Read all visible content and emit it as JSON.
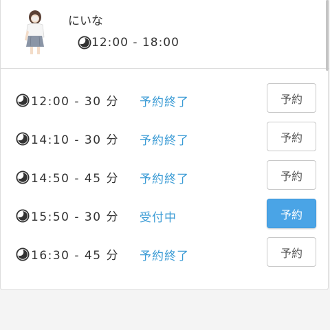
{
  "profile": {
    "name": "にいな",
    "hours": "12:00 - 18:00",
    "icon": "clock-icon"
  },
  "slots": [
    {
      "time": "12:00 - 30 分",
      "status": "予約終了",
      "button": "予約",
      "active": false
    },
    {
      "time": "14:10 - 30 分",
      "status": "予約終了",
      "button": "予約",
      "active": false
    },
    {
      "time": "14:50 - 45 分",
      "status": "予約終了",
      "button": "予約",
      "active": false
    },
    {
      "time": "15:50 - 30 分",
      "status": "受付中",
      "button": "予約",
      "active": true
    },
    {
      "time": "16:30 - 45 分",
      "status": "予約終了",
      "button": "予約",
      "active": false
    }
  ],
  "colors": {
    "status_text": "#3a9bd5",
    "active_button": "#4aa4e6"
  }
}
